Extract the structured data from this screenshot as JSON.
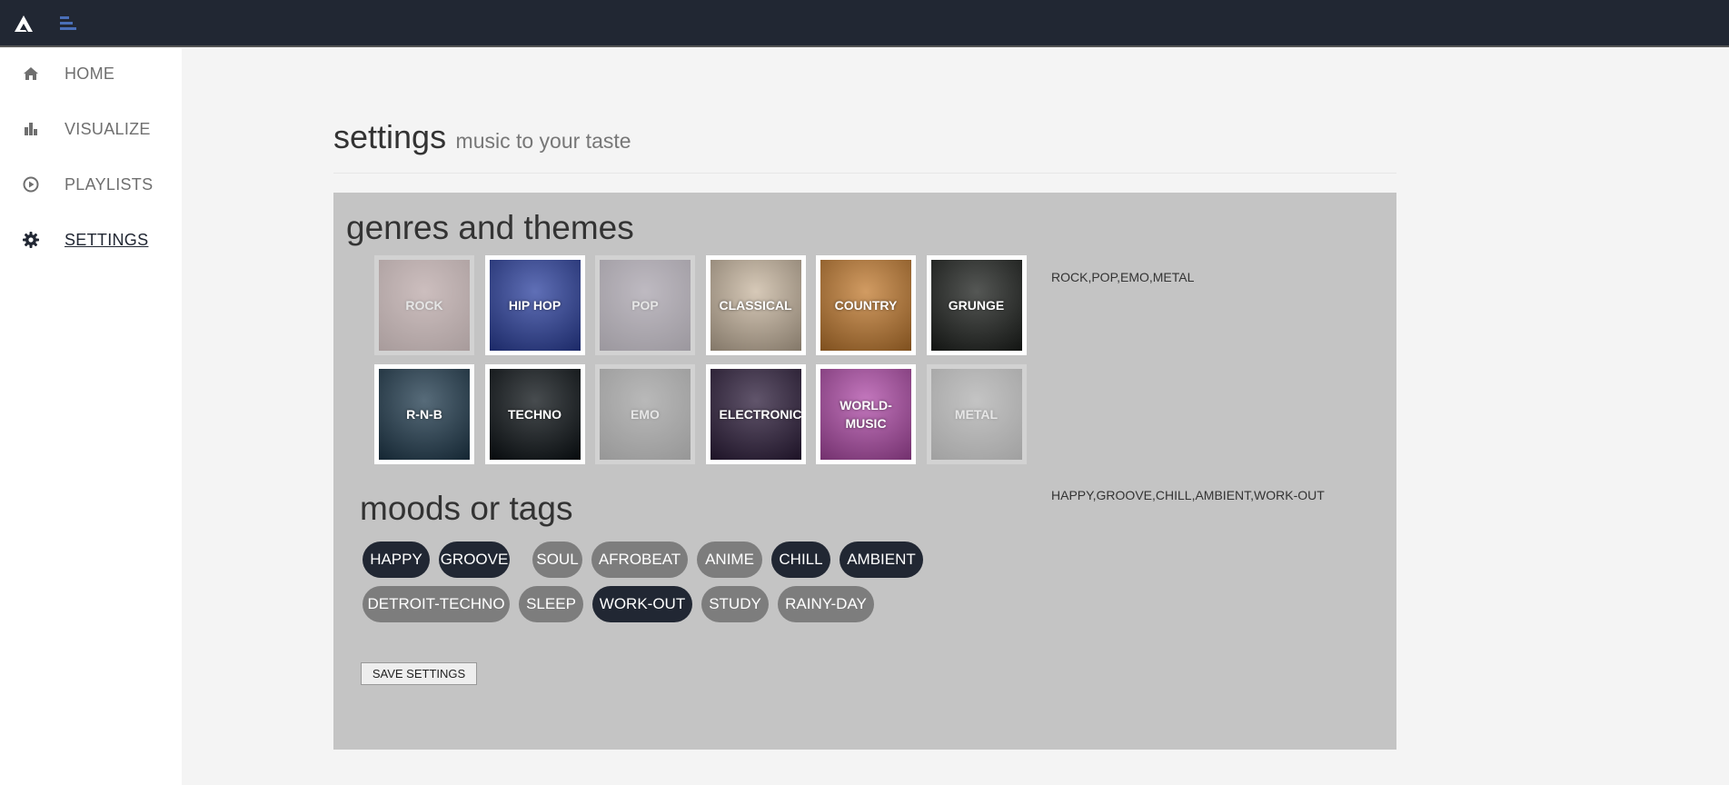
{
  "nav": {
    "items": [
      {
        "label": "HOME",
        "icon": "home-icon"
      },
      {
        "label": "VISUALIZE",
        "icon": "bar-chart-icon"
      },
      {
        "label": "PLAYLISTS",
        "icon": "play-circle-icon"
      },
      {
        "label": "SETTINGS",
        "icon": "gear-icon"
      }
    ],
    "active": "SETTINGS"
  },
  "header": {
    "title": "settings",
    "subtitle": "music to your taste"
  },
  "genres": {
    "title": "genres and themes",
    "items": [
      {
        "label": "ROCK",
        "selected": false,
        "color": "#b48a8a"
      },
      {
        "label": "HIP HOP",
        "selected": true,
        "color": "#2a3f9e"
      },
      {
        "label": "POP",
        "selected": false,
        "color": "#8a7d93"
      },
      {
        "label": "CLASSICAL",
        "selected": true,
        "color": "#c9b7a0"
      },
      {
        "label": "COUNTRY",
        "selected": true,
        "color": "#c27a2e"
      },
      {
        "label": "GRUNGE",
        "selected": true,
        "color": "#1c1f1c"
      },
      {
        "label": "R-N-B",
        "selected": true,
        "color": "#1f3a4d"
      },
      {
        "label": "TECHNO",
        "selected": true,
        "color": "#0a1014"
      },
      {
        "label": "EMO",
        "selected": false,
        "color": "#7a7a7a"
      },
      {
        "label": "ELECTRONIC",
        "selected": true,
        "color": "#2c1c3a"
      },
      {
        "label": "WORLD-MUSIC",
        "selected": true,
        "color": "#b04aa8"
      },
      {
        "label": "METAL",
        "selected": false,
        "color": "#9a9a9a"
      }
    ],
    "summary": "ROCK,POP,EMO,METAL"
  },
  "moods": {
    "title": "moods or tags",
    "items": [
      {
        "label": "HAPPY",
        "selected": true
      },
      {
        "label": "GROOVE",
        "selected": true
      },
      {
        "label": "SOUL",
        "selected": false
      },
      {
        "label": "AFROBEAT",
        "selected": false
      },
      {
        "label": "ANIME",
        "selected": false
      },
      {
        "label": "CHILL",
        "selected": true
      },
      {
        "label": "AMBIENT",
        "selected": true
      },
      {
        "label": "DETROIT-TECHNO",
        "selected": false
      },
      {
        "label": "SLEEP",
        "selected": false
      },
      {
        "label": "WORK-OUT",
        "selected": true
      },
      {
        "label": "STUDY",
        "selected": false
      },
      {
        "label": "RAINY-DAY",
        "selected": false
      }
    ],
    "summary": "HAPPY,GROOVE,CHILL,AMBIENT,WORK-OUT"
  },
  "actions": {
    "save_label": "SAVE SETTINGS"
  },
  "colors": {
    "topbar": "#212733",
    "accent": "#4a6fb8",
    "tag_on": "#212733",
    "tag_off": "#7d7d7d",
    "panel": "#c4c4c4"
  }
}
